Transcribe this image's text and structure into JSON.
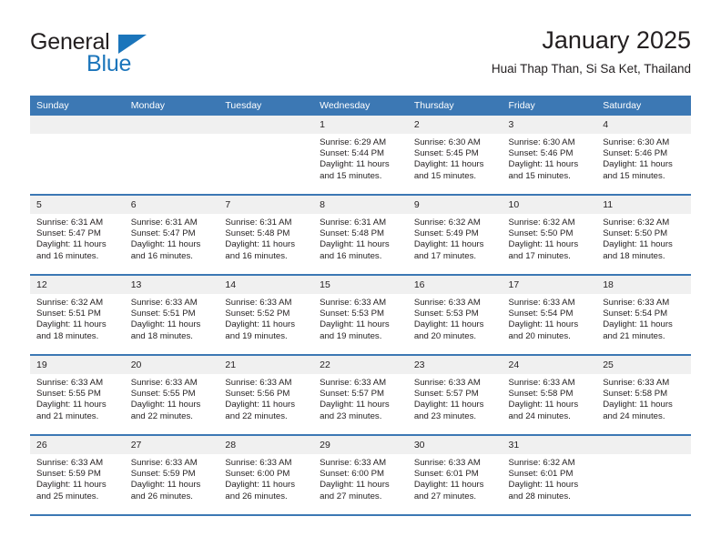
{
  "brand": {
    "name_part1": "General",
    "name_part2": "Blue",
    "triangle_color": "#1b75bb"
  },
  "header": {
    "title": "January 2025",
    "subtitle": "Huai Thap Than, Si Sa Ket, Thailand"
  },
  "theme": {
    "header_blue": "#3c78b4",
    "daynum_band": "#f0f0f0",
    "text": "#231f20"
  },
  "columns": [
    "Sunday",
    "Monday",
    "Tuesday",
    "Wednesday",
    "Thursday",
    "Friday",
    "Saturday"
  ],
  "weeks": [
    [
      {
        "day": "",
        "sunrise": "",
        "sunset": "",
        "daylight": "",
        "empty": true
      },
      {
        "day": "",
        "sunrise": "",
        "sunset": "",
        "daylight": "",
        "empty": true
      },
      {
        "day": "",
        "sunrise": "",
        "sunset": "",
        "daylight": "",
        "empty": true
      },
      {
        "day": "1",
        "sunrise": "Sunrise: 6:29 AM",
        "sunset": "Sunset: 5:44 PM",
        "daylight": "Daylight: 11 hours and 15 minutes."
      },
      {
        "day": "2",
        "sunrise": "Sunrise: 6:30 AM",
        "sunset": "Sunset: 5:45 PM",
        "daylight": "Daylight: 11 hours and 15 minutes."
      },
      {
        "day": "3",
        "sunrise": "Sunrise: 6:30 AM",
        "sunset": "Sunset: 5:46 PM",
        "daylight": "Daylight: 11 hours and 15 minutes."
      },
      {
        "day": "4",
        "sunrise": "Sunrise: 6:30 AM",
        "sunset": "Sunset: 5:46 PM",
        "daylight": "Daylight: 11 hours and 15 minutes."
      }
    ],
    [
      {
        "day": "5",
        "sunrise": "Sunrise: 6:31 AM",
        "sunset": "Sunset: 5:47 PM",
        "daylight": "Daylight: 11 hours and 16 minutes."
      },
      {
        "day": "6",
        "sunrise": "Sunrise: 6:31 AM",
        "sunset": "Sunset: 5:47 PM",
        "daylight": "Daylight: 11 hours and 16 minutes."
      },
      {
        "day": "7",
        "sunrise": "Sunrise: 6:31 AM",
        "sunset": "Sunset: 5:48 PM",
        "daylight": "Daylight: 11 hours and 16 minutes."
      },
      {
        "day": "8",
        "sunrise": "Sunrise: 6:31 AM",
        "sunset": "Sunset: 5:48 PM",
        "daylight": "Daylight: 11 hours and 16 minutes."
      },
      {
        "day": "9",
        "sunrise": "Sunrise: 6:32 AM",
        "sunset": "Sunset: 5:49 PM",
        "daylight": "Daylight: 11 hours and 17 minutes."
      },
      {
        "day": "10",
        "sunrise": "Sunrise: 6:32 AM",
        "sunset": "Sunset: 5:50 PM",
        "daylight": "Daylight: 11 hours and 17 minutes."
      },
      {
        "day": "11",
        "sunrise": "Sunrise: 6:32 AM",
        "sunset": "Sunset: 5:50 PM",
        "daylight": "Daylight: 11 hours and 18 minutes."
      }
    ],
    [
      {
        "day": "12",
        "sunrise": "Sunrise: 6:32 AM",
        "sunset": "Sunset: 5:51 PM",
        "daylight": "Daylight: 11 hours and 18 minutes."
      },
      {
        "day": "13",
        "sunrise": "Sunrise: 6:33 AM",
        "sunset": "Sunset: 5:51 PM",
        "daylight": "Daylight: 11 hours and 18 minutes."
      },
      {
        "day": "14",
        "sunrise": "Sunrise: 6:33 AM",
        "sunset": "Sunset: 5:52 PM",
        "daylight": "Daylight: 11 hours and 19 minutes."
      },
      {
        "day": "15",
        "sunrise": "Sunrise: 6:33 AM",
        "sunset": "Sunset: 5:53 PM",
        "daylight": "Daylight: 11 hours and 19 minutes."
      },
      {
        "day": "16",
        "sunrise": "Sunrise: 6:33 AM",
        "sunset": "Sunset: 5:53 PM",
        "daylight": "Daylight: 11 hours and 20 minutes."
      },
      {
        "day": "17",
        "sunrise": "Sunrise: 6:33 AM",
        "sunset": "Sunset: 5:54 PM",
        "daylight": "Daylight: 11 hours and 20 minutes."
      },
      {
        "day": "18",
        "sunrise": "Sunrise: 6:33 AM",
        "sunset": "Sunset: 5:54 PM",
        "daylight": "Daylight: 11 hours and 21 minutes."
      }
    ],
    [
      {
        "day": "19",
        "sunrise": "Sunrise: 6:33 AM",
        "sunset": "Sunset: 5:55 PM",
        "daylight": "Daylight: 11 hours and 21 minutes."
      },
      {
        "day": "20",
        "sunrise": "Sunrise: 6:33 AM",
        "sunset": "Sunset: 5:55 PM",
        "daylight": "Daylight: 11 hours and 22 minutes."
      },
      {
        "day": "21",
        "sunrise": "Sunrise: 6:33 AM",
        "sunset": "Sunset: 5:56 PM",
        "daylight": "Daylight: 11 hours and 22 minutes."
      },
      {
        "day": "22",
        "sunrise": "Sunrise: 6:33 AM",
        "sunset": "Sunset: 5:57 PM",
        "daylight": "Daylight: 11 hours and 23 minutes."
      },
      {
        "day": "23",
        "sunrise": "Sunrise: 6:33 AM",
        "sunset": "Sunset: 5:57 PM",
        "daylight": "Daylight: 11 hours and 23 minutes."
      },
      {
        "day": "24",
        "sunrise": "Sunrise: 6:33 AM",
        "sunset": "Sunset: 5:58 PM",
        "daylight": "Daylight: 11 hours and 24 minutes."
      },
      {
        "day": "25",
        "sunrise": "Sunrise: 6:33 AM",
        "sunset": "Sunset: 5:58 PM",
        "daylight": "Daylight: 11 hours and 24 minutes."
      }
    ],
    [
      {
        "day": "26",
        "sunrise": "Sunrise: 6:33 AM",
        "sunset": "Sunset: 5:59 PM",
        "daylight": "Daylight: 11 hours and 25 minutes."
      },
      {
        "day": "27",
        "sunrise": "Sunrise: 6:33 AM",
        "sunset": "Sunset: 5:59 PM",
        "daylight": "Daylight: 11 hours and 26 minutes."
      },
      {
        "day": "28",
        "sunrise": "Sunrise: 6:33 AM",
        "sunset": "Sunset: 6:00 PM",
        "daylight": "Daylight: 11 hours and 26 minutes."
      },
      {
        "day": "29",
        "sunrise": "Sunrise: 6:33 AM",
        "sunset": "Sunset: 6:00 PM",
        "daylight": "Daylight: 11 hours and 27 minutes."
      },
      {
        "day": "30",
        "sunrise": "Sunrise: 6:33 AM",
        "sunset": "Sunset: 6:01 PM",
        "daylight": "Daylight: 11 hours and 27 minutes."
      },
      {
        "day": "31",
        "sunrise": "Sunrise: 6:32 AM",
        "sunset": "Sunset: 6:01 PM",
        "daylight": "Daylight: 11 hours and 28 minutes."
      },
      {
        "day": "",
        "sunrise": "",
        "sunset": "",
        "daylight": "",
        "empty": true
      }
    ]
  ]
}
